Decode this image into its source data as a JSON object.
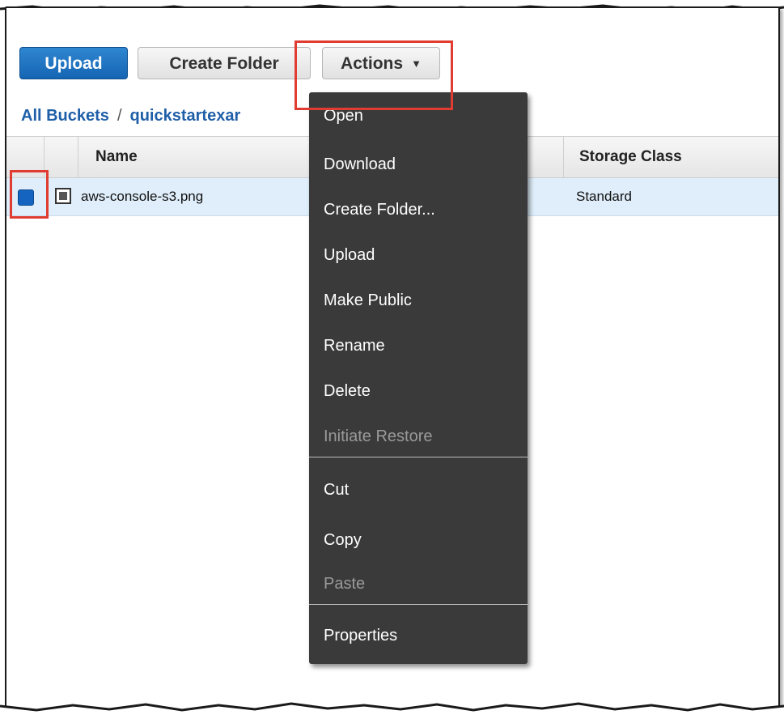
{
  "toolbar": {
    "upload_label": "Upload",
    "create_folder_label": "Create Folder",
    "actions_label": "Actions",
    "actions_caret_icon": "chevron-down-icon"
  },
  "breadcrumb": {
    "root": "All Buckets",
    "separator": "/",
    "current": "quickstartexar"
  },
  "table": {
    "columns": [
      "Name",
      "Storage Class"
    ],
    "rows": [
      {
        "name": "aws-console-s3.png",
        "storage_class": "Standard",
        "selected": true
      }
    ]
  },
  "actions_menu": {
    "items": [
      {
        "label": "Open",
        "enabled": true
      },
      {
        "label": "Download",
        "enabled": true
      },
      {
        "label": "Create Folder...",
        "enabled": true
      },
      {
        "label": "Upload",
        "enabled": true
      },
      {
        "label": "Make Public",
        "enabled": true
      },
      {
        "label": "Rename",
        "enabled": true
      },
      {
        "label": "Delete",
        "enabled": true
      },
      {
        "label": "Initiate Restore",
        "enabled": false
      },
      {
        "label": "Cut",
        "enabled": true
      },
      {
        "label": "Copy",
        "enabled": true
      },
      {
        "label": "Paste",
        "enabled": false
      },
      {
        "label": "Properties",
        "enabled": true
      }
    ]
  },
  "colors": {
    "primary_button": "#1565b3",
    "highlight": "#e03c31",
    "link": "#1f5fa8",
    "menu_background": "#3a3a3a",
    "selected_row": "#dfeefa"
  }
}
